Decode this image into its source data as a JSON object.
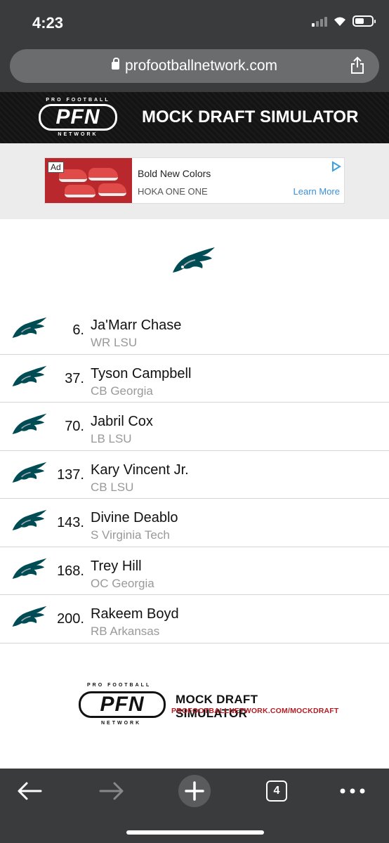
{
  "status_bar": {
    "time": "4:23"
  },
  "browser": {
    "url": "profootballnetwork.com",
    "tab_count": "4"
  },
  "header": {
    "logo_top": "PRO FOOTBALL",
    "logo_main": "PFN",
    "logo_bottom": "NETWORK",
    "title": "MOCK DRAFT SIMULATOR"
  },
  "ad": {
    "badge": "Ad",
    "title": "Bold New Colors",
    "brand": "HOKA ONE ONE",
    "cta": "Learn More"
  },
  "picks": [
    {
      "number": "6.",
      "name": "Ja'Marr Chase",
      "detail": "WR LSU"
    },
    {
      "number": "37.",
      "name": "Tyson Campbell",
      "detail": "CB Georgia"
    },
    {
      "number": "70.",
      "name": "Jabril Cox",
      "detail": "LB LSU"
    },
    {
      "number": "137.",
      "name": "Kary Vincent Jr.",
      "detail": "CB LSU"
    },
    {
      "number": "143.",
      "name": "Divine Deablo",
      "detail": "S Virginia Tech"
    },
    {
      "number": "168.",
      "name": "Trey Hill",
      "detail": "OC Georgia"
    },
    {
      "number": "200.",
      "name": "Rakeem Boyd",
      "detail": "RB Arkansas"
    }
  ],
  "footer": {
    "logo_top": "PRO FOOTBALL",
    "logo_main": "PFN",
    "logo_bottom": "NETWORK",
    "title": "MOCK DRAFT SIMULATOR",
    "url": "PROFOOTBALLNETWORK.COM/MOCKDRAFT"
  },
  "colors": {
    "chrome": "#3a3b3d",
    "accent_red": "#b51b22",
    "eagle_green": "#004c54"
  }
}
